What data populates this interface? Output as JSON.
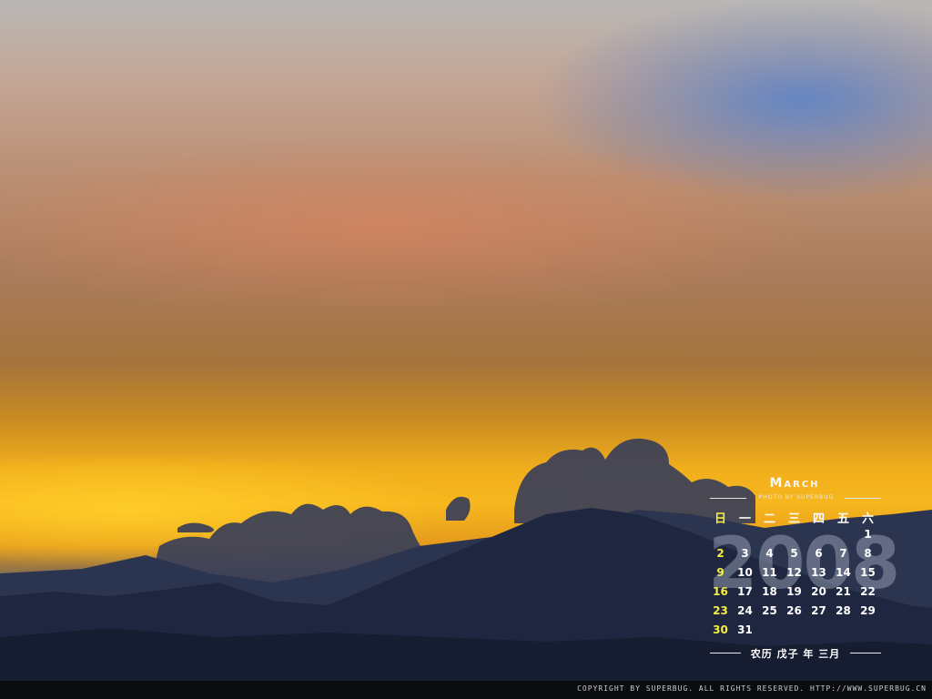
{
  "calendar": {
    "month": "March",
    "credit": "PHOTO BY SUPERBUG",
    "year": "2008",
    "weekdays": [
      "日",
      "一",
      "二",
      "三",
      "四",
      "五",
      "六"
    ],
    "weeks": [
      [
        "",
        "",
        "",
        "",
        "",
        "",
        "1"
      ],
      [
        "2",
        "3",
        "4",
        "5",
        "6",
        "7",
        "8"
      ],
      [
        "9",
        "10",
        "11",
        "12",
        "13",
        "14",
        "15"
      ],
      [
        "16",
        "17",
        "18",
        "19",
        "20",
        "21",
        "22"
      ],
      [
        "23",
        "24",
        "25",
        "26",
        "27",
        "28",
        "29"
      ],
      [
        "30",
        "31",
        "",
        "",
        "",
        "",
        ""
      ]
    ],
    "lunar": "农历 戊子 年 三月"
  },
  "footer": {
    "copyright": "COPYRIGHT BY SUPERBUG. ALL RIGHTS RESERVED. HTTP://WWW.SUPERBUG.CN"
  },
  "colors": {
    "sunday": "#f5ef45",
    "text": "#ffffff"
  }
}
